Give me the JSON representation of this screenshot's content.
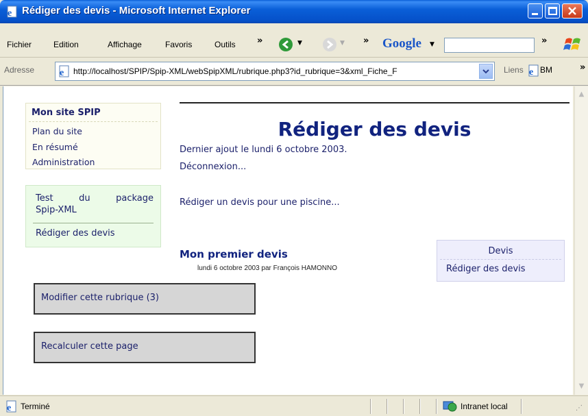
{
  "window": {
    "title": "Rédiger des devis - Microsoft Internet Explorer",
    "controls": {
      "minimize": "minimize-icon",
      "maximize": "maximize-icon",
      "close": "close-icon"
    }
  },
  "menubar": {
    "items": [
      "Fichier",
      "Edition",
      "Affichage",
      "Favoris",
      "Outils"
    ],
    "google_label": "Google",
    "search_value": ""
  },
  "addressbar": {
    "label": "Adresse",
    "url": "http://localhost/SPIP/Spip-XML/webSpipXML/rubrique.php3?id_rubrique=3&xml_Fiche_F",
    "links_label": "Liens",
    "bookmark_label": "BM"
  },
  "sidebar": {
    "site_box": {
      "title": "Mon site SPIP",
      "links": [
        "Plan du site",
        "En résumé",
        "Administration"
      ]
    },
    "section_box": {
      "parent_line1": "Test du package",
      "parent_line2": "Spip-XML",
      "current": "Rédiger des devis"
    }
  },
  "main": {
    "page_title": "Rédiger des devis",
    "last_update": "Dernier ajout le lundi 6 octobre 2003.",
    "logout": "Déconnexion...",
    "intro_link": "Rédiger un devis pour une piscine...",
    "article": {
      "title": "Mon premier devis",
      "meta": "lundi 6 octobre 2003 par François HAMONNO"
    },
    "side_box": {
      "title": "Devis",
      "link": "Rédiger des devis"
    },
    "admin_buttons": {
      "modify": "Modifier cette rubrique (3)",
      "recalc": "Recalculer cette page"
    }
  },
  "statusbar": {
    "status": "Terminé",
    "zone": "Intranet local"
  },
  "colors": {
    "titlebar": "#0a5fd8",
    "link_text": "#1a1f6a",
    "page_title": "#11237f"
  }
}
